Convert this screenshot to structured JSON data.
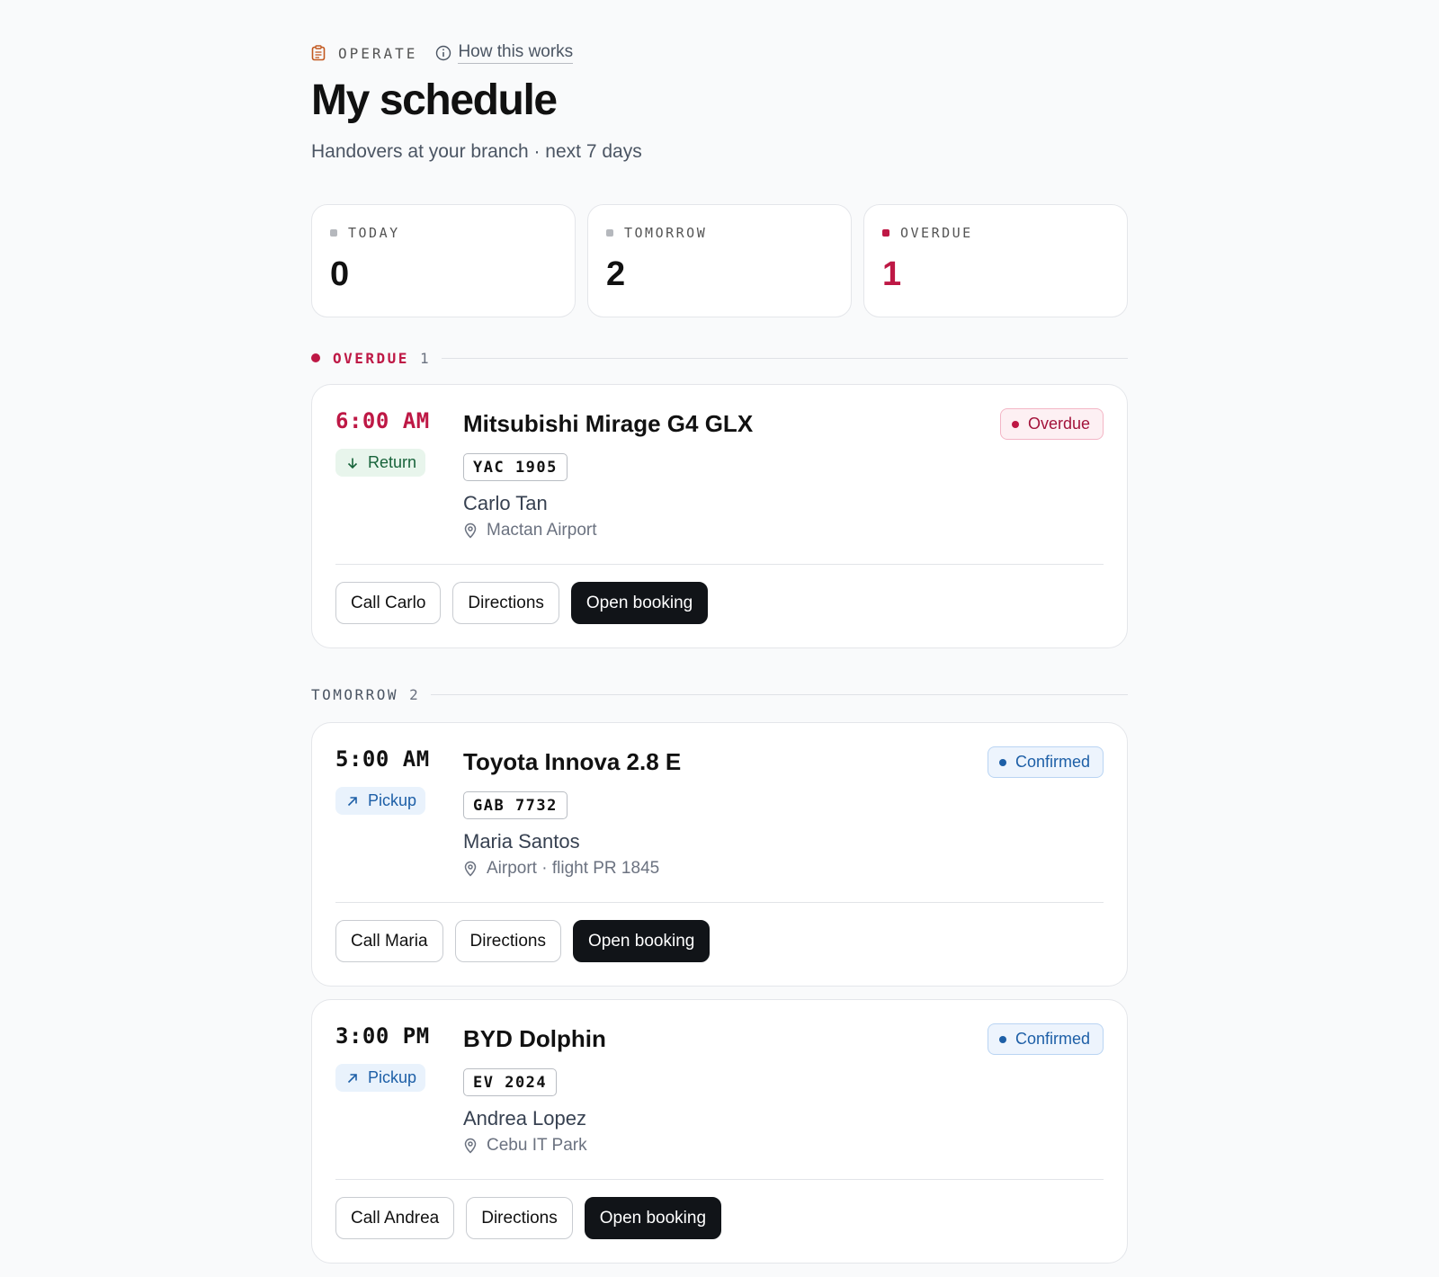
{
  "header": {
    "section_label": "OPERATE",
    "how_link": "How this works",
    "title": "My schedule",
    "subtitle": "Handovers at your branch · next 7 days"
  },
  "colors": {
    "accent_red": "#be1845",
    "return_green": "#17633a",
    "pickup_blue": "#1d5fa7",
    "primary_button": "#111418"
  },
  "stats": [
    {
      "label": "TODAY",
      "value": "0",
      "tone": "neutral"
    },
    {
      "label": "TOMORROW",
      "value": "2",
      "tone": "neutral"
    },
    {
      "label": "OVERDUE",
      "value": "1",
      "tone": "alert"
    }
  ],
  "groups": [
    {
      "name": "OVERDUE",
      "count": "1",
      "bookings": [
        {
          "time": "6:00 AM",
          "kind": "Return",
          "kind_icon": "arrow-down-icon",
          "vehicle": "Mitsubishi Mirage G4 GLX",
          "plate": "YAC 1905",
          "customer": "Carlo Tan",
          "location": "Mactan Airport",
          "status": "Overdue",
          "actions": {
            "call": "Call Carlo",
            "directions": "Directions",
            "open": "Open booking"
          }
        }
      ]
    },
    {
      "name": "TOMORROW",
      "count": "2",
      "bookings": [
        {
          "time": "5:00 AM",
          "kind": "Pickup",
          "kind_icon": "arrow-up-right-icon",
          "vehicle": "Toyota Innova 2.8 E",
          "plate": "GAB 7732",
          "customer": "Maria Santos",
          "location": "Airport · flight PR 1845",
          "status": "Confirmed",
          "actions": {
            "call": "Call Maria",
            "directions": "Directions",
            "open": "Open booking"
          }
        },
        {
          "time": "3:00 PM",
          "kind": "Pickup",
          "kind_icon": "arrow-up-right-icon",
          "vehicle": "BYD Dolphin",
          "plate": "EV 2024",
          "customer": "Andrea Lopez",
          "location": "Cebu IT Park",
          "status": "Confirmed",
          "actions": {
            "call": "Call Andrea",
            "directions": "Directions",
            "open": "Open booking"
          }
        }
      ]
    }
  ]
}
